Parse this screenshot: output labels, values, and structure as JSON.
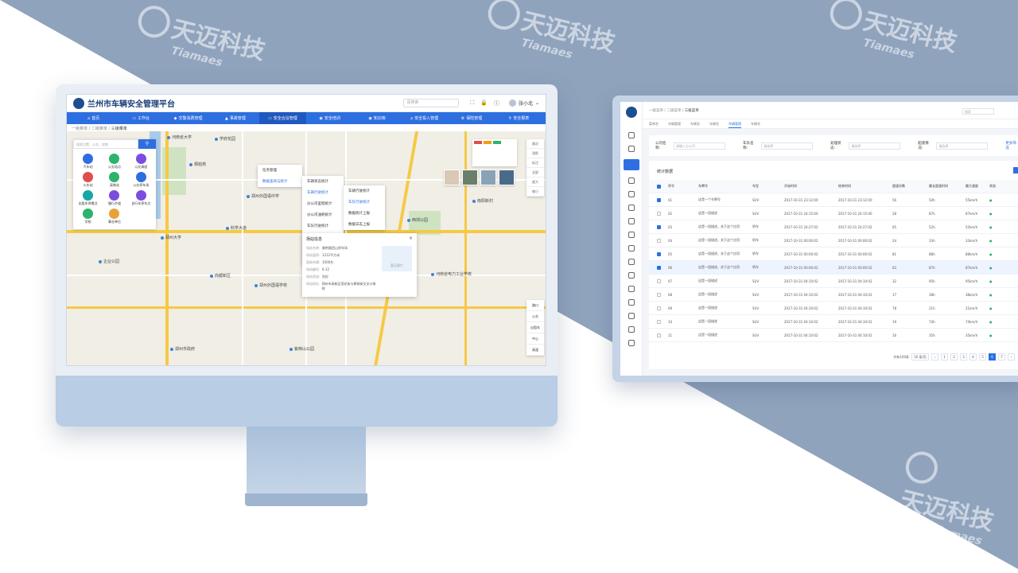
{
  "watermark": {
    "cn": "天迈科技",
    "en": "Tiamaes"
  },
  "platform": {
    "title": "兰州市车辆安全管理平台",
    "search_placeholder": "请搜索",
    "user": "张小北",
    "nav": [
      "首页",
      "工作台",
      "交警消费管理",
      "事故管理",
      "安全合议管理",
      "安全培训",
      "知识库",
      "安全投入管理",
      "保险管理",
      "安全报表"
    ],
    "breadcrumb": [
      "一级菜单",
      "二级菜单",
      "三级菜单"
    ],
    "map_search_placeholder": "搜索位置、公交、地铁",
    "map_search_btn": "搜索",
    "poi_types": [
      "汽车站",
      "公交站点",
      "公交调度",
      "火车站",
      "高铁站",
      "公交停车场",
      "出租车停靠点",
      "慢行步道",
      "自行车停车点",
      "学校",
      "事业单位"
    ],
    "menu1": [
      "任务管理",
      "数据查询与统计"
    ],
    "menu2": [
      "车辆状态统计",
      "车辆行驶统计",
      "分公司里程统计",
      "分公司油耗统计",
      "车队行驶统计",
      "车队状态统计",
      "数据统计上报",
      "数据日志上报"
    ],
    "menu3": [
      "车辆行驶统计",
      "车队行驶统计",
      "数据统计上报",
      "数据日志上报"
    ],
    "map_tools": [
      "路况",
      "测距",
      "标注",
      "全屏",
      "放大",
      "缩小"
    ],
    "map_layers": [
      "路口",
      "公交",
      "出租车",
      "中心",
      "高速"
    ],
    "info": {
      "title": "场站信息",
      "rows": [
        [
          "场站名称:",
          "紫荆路西山停车场"
        ],
        [
          "场站面积:",
          "1212平方米"
        ],
        [
          "容纳车辆:",
          "1000台"
        ],
        [
          "场站编号:",
          "6-12"
        ],
        [
          "场站状态:",
          "良好"
        ],
        [
          "场站地址:",
          "郑州市高新区莲花街与枫杨街交叉口南侧"
        ]
      ],
      "photo_label": "暂无图片"
    },
    "poi_labels": [
      "河南省大学",
      "学府花园",
      "桐柏苑",
      "郑州外国语中学",
      "郑州大学",
      "科学大道",
      "企业公园",
      "河南省电力工业学校",
      "南阳新村",
      "郑州外国语学校",
      "西郊公园",
      "商都新区",
      "紫荆山公园",
      "郑州市政府"
    ]
  },
  "tablet": {
    "breadcrumb": [
      "一级菜单",
      "二级菜单",
      "三级菜单"
    ],
    "tabs": [
      "菜单名",
      "车辆管理",
      "车辆名",
      "车辆名",
      "车辆管理",
      "车辆名"
    ],
    "search_placeholder": "搜索",
    "filters": [
      {
        "label": "公司名称:",
        "placeholder": "请输入分公司"
      },
      {
        "label": "车队名称:",
        "placeholder": "请选择"
      },
      {
        "label": "处理状态:",
        "placeholder": "请选择"
      },
      {
        "label": "超速情况:",
        "placeholder": "请选择"
      }
    ],
    "more": "更多筛选",
    "table_title": "统计数据",
    "columns": [
      "序号",
      "车牌号",
      "车型",
      "开始时间",
      "结束时间",
      "超速次数",
      "最长超速时间",
      "最大速度",
      "状态"
    ],
    "rows": [
      {
        "no": "01",
        "plate": "这是一个车牌号",
        "type": "SUV",
        "start": "2017-10-31 23:12:00",
        "end": "2017-10-31 23:12:00",
        "cnt": "56",
        "dur": "50h",
        "speed": "55km/h",
        "checked": true
      },
      {
        "no": "02",
        "plate": "这是一段描述",
        "type": "SUV",
        "start": "2017-10-31 24:15:00",
        "end": "2017-10-31 24:15:00",
        "cnt": "28",
        "dur": "87h",
        "speed": "87km/h",
        "checked": false
      },
      {
        "no": "03",
        "plate": "这是一段描述，关于这个应用",
        "type": "轿车",
        "start": "2017-10-31 24:27:02",
        "end": "2017-10-31 24:27:02",
        "cnt": "65",
        "dur": "52h",
        "speed": "52km/h",
        "checked": true
      },
      {
        "no": "04",
        "plate": "这是一段描述，关于这个应用",
        "type": "轿车",
        "start": "2017-10-31 00:00:02",
        "end": "2017-10-31 00:00:02",
        "cnt": "24",
        "dur": "33h",
        "speed": "33km/h",
        "checked": false
      },
      {
        "no": "05",
        "plate": "这是一段描述，关于这个应用",
        "type": "轿车",
        "start": "2017-10-31 00:00:02",
        "end": "2017-10-31 00:00:02",
        "cnt": "81",
        "dur": "88h",
        "speed": "88km/h",
        "checked": true
      },
      {
        "no": "06",
        "plate": "这是一段描述，关于这个应用",
        "type": "轿车",
        "start": "2017-10-31 00:00:02",
        "end": "2017-10-31 00:00:02",
        "cnt": "63",
        "dur": "87h",
        "speed": "87km/h",
        "checked": true
      },
      {
        "no": "07",
        "plate": "这是一段描述",
        "type": "SUV",
        "start": "2017-10-31 04:10:02",
        "end": "2017-10-31 04:10:02",
        "cnt": "32",
        "dur": "95h",
        "speed": "95km/h",
        "checked": false
      },
      {
        "no": "08",
        "plate": "这是一段描述",
        "type": "SUV",
        "start": "2017-10-31 04:10:02",
        "end": "2017-10-31 04:10:02",
        "cnt": "17",
        "dur": "38h",
        "speed": "38km/h",
        "checked": false
      },
      {
        "no": "09",
        "plate": "这是一段描述",
        "type": "SUV",
        "start": "2017-10-31 04:10:02",
        "end": "2017-10-31 04:10:02",
        "cnt": "78",
        "dur": "21h",
        "speed": "21km/h",
        "checked": false
      },
      {
        "no": "10",
        "plate": "这是一段描述",
        "type": "SUV",
        "start": "2017-10-31 04:10:02",
        "end": "2017-10-31 04:10:02",
        "cnt": "19",
        "dur": "74h",
        "speed": "74km/h",
        "checked": false
      },
      {
        "no": "11",
        "plate": "这是一段描述",
        "type": "SUV",
        "start": "2017-10-31 04:10:02",
        "end": "2017-10-31 04:10:02",
        "cnt": "16",
        "dur": "35h",
        "speed": "35km/h",
        "checked": false
      }
    ],
    "pager": {
      "total": "共有100条",
      "size": "10 条/页",
      "pages": [
        "1",
        "2",
        "3",
        "4",
        "5",
        "6",
        "7"
      ],
      "current": "6"
    }
  },
  "colors": {
    "primary": "#2d6fe0",
    "band": "#8fa3bd",
    "device": "#b9cde4"
  }
}
